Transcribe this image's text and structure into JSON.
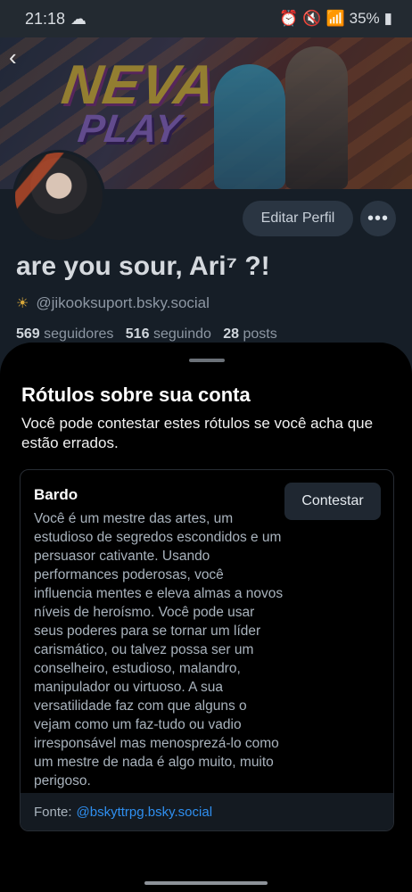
{
  "status": {
    "time": "21:18",
    "battery": "35%"
  },
  "banner": {
    "title": "NEVA",
    "subtitle": "PLAY"
  },
  "profile": {
    "edit_label": "Editar Perfil",
    "more_label": "•••",
    "display_name": "are you sour, Ari⁷ ?!",
    "handle": "@jikooksuport.bsky.social",
    "followers_count": "569",
    "followers_label": "seguidores",
    "following_count": "516",
    "following_label": "seguindo",
    "posts_count": "28",
    "posts_label": "posts"
  },
  "sheet": {
    "title": "Rótulos sobre sua conta",
    "description": "Você pode contestar estes rótulos se você acha que estão errados.",
    "label": {
      "name": "Bardo",
      "description": "Você é um mestre das artes, um estudioso de segredos escondidos e um persuasor cativante. Usando performances poderosas, você influencia mentes e eleva almas a novos níveis de heroísmo. Você pode usar seus poderes para se tornar um líder carismático, ou talvez possa ser um conselheiro, estudioso, malandro, manipulador ou virtuoso. A sua versatilidade faz com que alguns o vejam como um faz-tudo ou vadio irresponsável mas menosprezá-lo como um mestre de nada é algo muito, muito perigoso.",
      "button": "Contestar",
      "source_label": "Fonte:",
      "source_link": "@bskyttrpg.bsky.social"
    }
  },
  "colors": {
    "accent": "#2f8ff0",
    "background": "#000000",
    "profile_bg": "#161e27"
  }
}
